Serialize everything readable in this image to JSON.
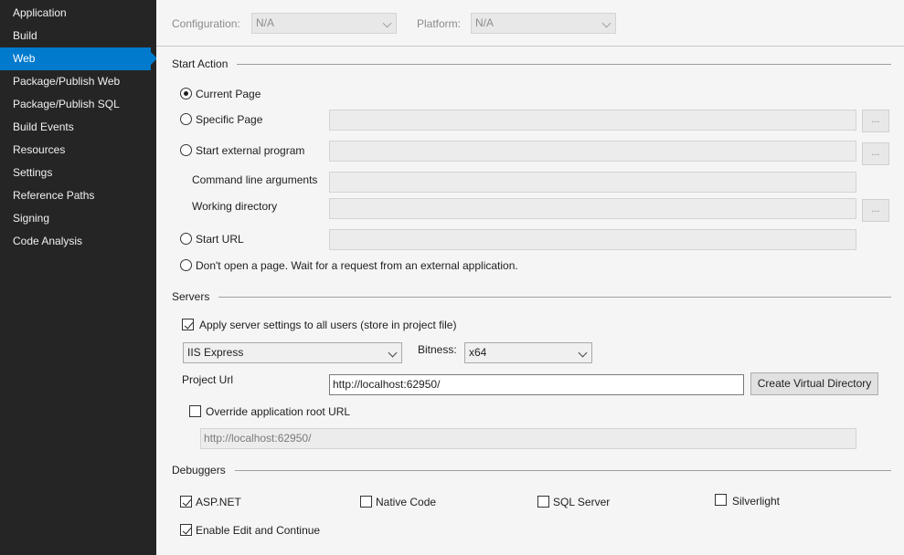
{
  "sidebar": {
    "items": [
      {
        "label": "Application"
      },
      {
        "label": "Build"
      },
      {
        "label": "Web"
      },
      {
        "label": "Package/Publish Web"
      },
      {
        "label": "Package/Publish SQL"
      },
      {
        "label": "Build Events"
      },
      {
        "label": "Resources"
      },
      {
        "label": "Settings"
      },
      {
        "label": "Reference Paths"
      },
      {
        "label": "Signing"
      },
      {
        "label": "Code Analysis"
      }
    ],
    "active": "Web"
  },
  "top": {
    "configuration_label": "Configuration:",
    "configuration_value": "N/A",
    "platform_label": "Platform:",
    "platform_value": "N/A"
  },
  "start_action": {
    "title": "Start Action",
    "current_page": "Current Page",
    "specific_page": "Specific Page",
    "start_external_program": "Start external program",
    "command_line_arguments": "Command line arguments",
    "working_directory": "Working directory",
    "start_url": "Start URL",
    "dont_open": "Don't open a page.  Wait for a request from an external application.",
    "browse_label": "...",
    "selected": "Current Page"
  },
  "servers": {
    "title": "Servers",
    "apply_settings_label": "Apply server settings to all users (store in project file)",
    "apply_settings_checked": true,
    "server_value": "IIS Express",
    "bitness_label": "Bitness:",
    "bitness_value": "x64",
    "project_url_label": "Project Url",
    "project_url_value": "http://localhost:62950/",
    "create_vdir_label": "Create Virtual Directory",
    "override_label": "Override application root URL",
    "override_checked": false,
    "override_value": "http://localhost:62950/"
  },
  "debuggers": {
    "title": "Debuggers",
    "aspnet": "ASP.NET",
    "aspnet_checked": true,
    "native_code": "Native Code",
    "native_code_checked": false,
    "sql_server": "SQL Server",
    "sql_server_checked": false,
    "silverlight": "Silverlight",
    "silverlight_checked": false,
    "edit_continue": "Enable Edit and Continue",
    "edit_continue_checked": true
  },
  "colors": {
    "sidebar_bg": "#252526",
    "accent": "#007acc",
    "content_bg": "#f5f5f5"
  }
}
